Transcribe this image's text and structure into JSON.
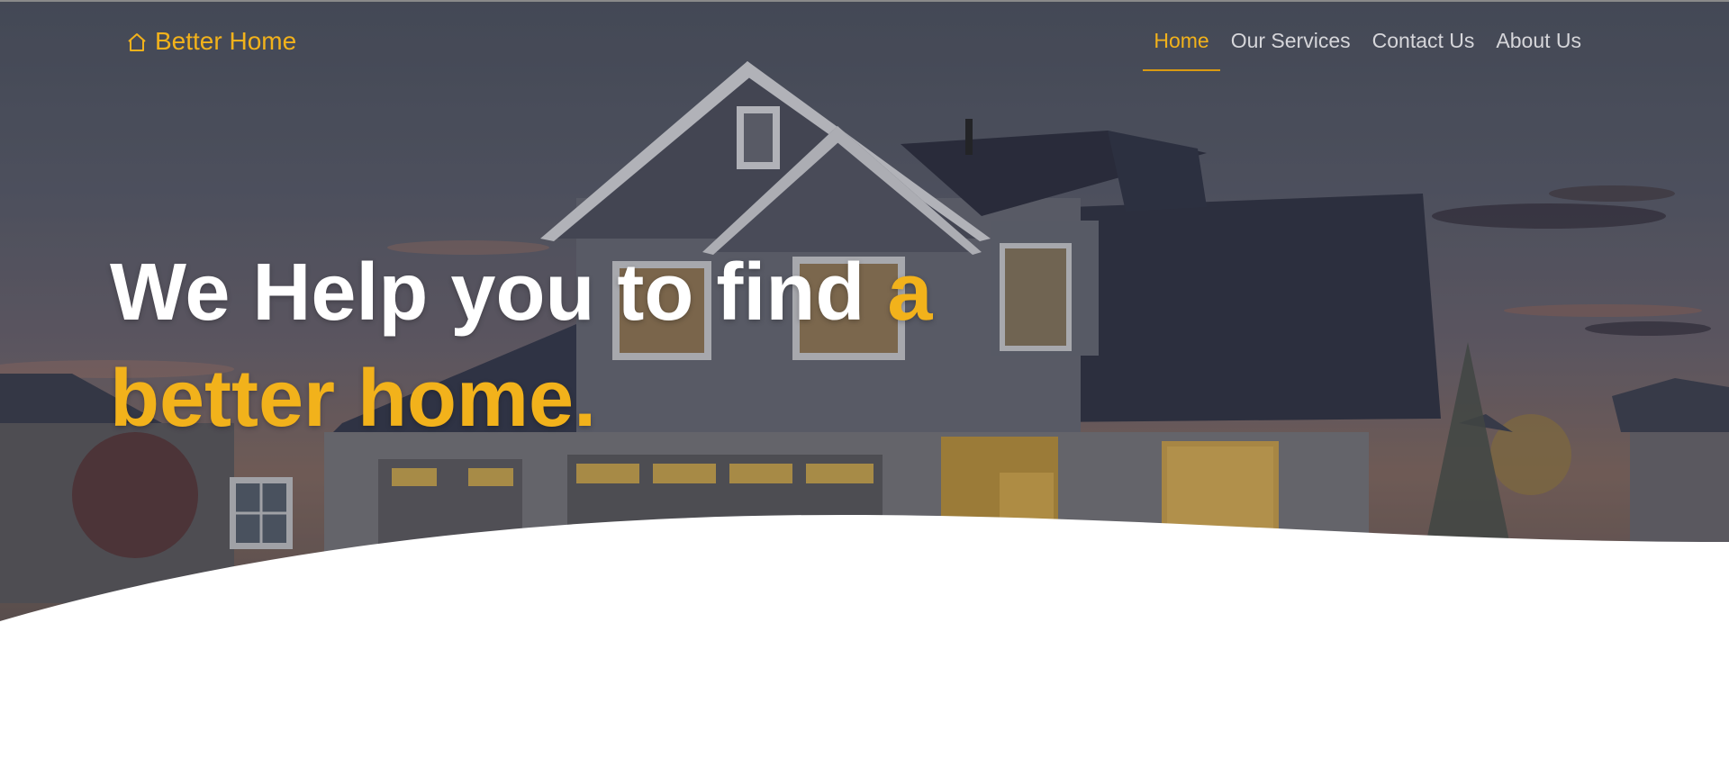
{
  "brand": {
    "name": "Better Home",
    "icon": "home-icon",
    "color": "#f2b21b"
  },
  "nav": {
    "items": [
      {
        "label": "Home",
        "active": true
      },
      {
        "label": "Our Services",
        "active": false
      },
      {
        "label": "Contact Us",
        "active": false
      },
      {
        "label": "About Us",
        "active": false
      }
    ]
  },
  "hero": {
    "headline_white": "We Help you to find",
    "headline_accent_1": "a",
    "headline_accent_2": "better home.",
    "accent_color": "#f2b21b",
    "background_image": "house-at-dusk-photo"
  }
}
